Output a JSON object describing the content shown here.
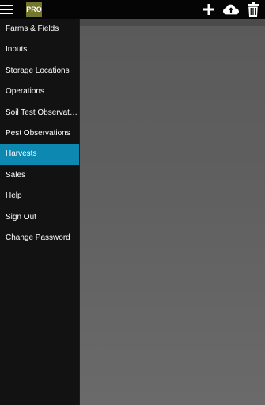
{
  "topbar": {
    "menu_icon": "hamburger-menu-icon",
    "badge": "PRO",
    "actions": [
      {
        "name": "add-button",
        "icon": "plus-icon"
      },
      {
        "name": "cloud-sync-button",
        "icon": "cloud-upload-icon"
      },
      {
        "name": "delete-button",
        "icon": "trash-icon"
      }
    ]
  },
  "sidebar": {
    "items": [
      {
        "label": "Farms & Fields",
        "active": false
      },
      {
        "label": "Inputs",
        "active": false
      },
      {
        "label": "Storage Locations",
        "active": false
      },
      {
        "label": "Operations",
        "active": false
      },
      {
        "label": "Soil Test Observations",
        "active": false
      },
      {
        "label": "Pest Observations",
        "active": false
      },
      {
        "label": "Harvests",
        "active": true
      },
      {
        "label": "Sales",
        "active": false
      },
      {
        "label": "Help",
        "active": false
      },
      {
        "label": "Sign Out",
        "active": false
      },
      {
        "label": "Change Password",
        "active": false
      }
    ]
  },
  "colors": {
    "topbar_bg": "#050505",
    "badge_bg": "#75762d",
    "sidebar_bg": "#121212",
    "active_bg": "#0d88b0",
    "content_bg": "#5f5f5f"
  }
}
